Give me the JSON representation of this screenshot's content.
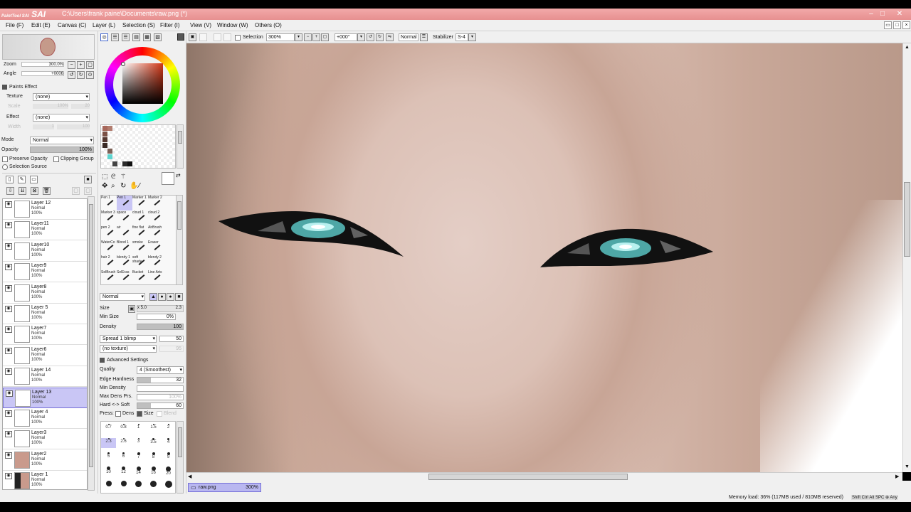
{
  "app": {
    "logo_text": "PaintTool SAI",
    "title": "C:\\Users\\frank paine\\Documents\\raw.png (*)",
    "win_min": "–",
    "win_max": "□",
    "win_close": "✕"
  },
  "menu": [
    "File (F)",
    "Edit (E)",
    "Canvas (C)",
    "Layer (L)",
    "Selection (S)",
    "Filter (I)",
    "View (V)",
    "Window (W)",
    "Others (O)"
  ],
  "navigator": {
    "zoom_label": "Zoom",
    "zoom_value": "300.0%",
    "angle_label": "Angle",
    "angle_value": "+0006"
  },
  "paints_effect": {
    "header": "Paints Effect",
    "texture_label": "Texture",
    "texture_value": "(none)",
    "texture_scale": "Scale",
    "texture_scale_value": "100%",
    "texture_scale_num": "20",
    "effect_label": "Effect",
    "effect_value": "(none)",
    "effect_width": "Width",
    "effect_width_num": "1",
    "effect_width_value": "100"
  },
  "layer_props": {
    "mode_label": "Mode",
    "mode_value": "Normal",
    "opacity_label": "Opacity",
    "opacity_value": "100%",
    "preserve_opacity": "Preserve Opacity",
    "clipping_group": "Clipping Group",
    "selection_source": "Selection Source"
  },
  "layers": [
    {
      "name": "Layer 12",
      "mode": "Normal",
      "opacity": "100%",
      "selected": false
    },
    {
      "name": "Layer11",
      "mode": "Normal",
      "opacity": "100%",
      "selected": false
    },
    {
      "name": "Layer10",
      "mode": "Normal",
      "opacity": "100%",
      "selected": false
    },
    {
      "name": "Layer9",
      "mode": "Normal",
      "opacity": "100%",
      "selected": false
    },
    {
      "name": "Layer8",
      "mode": "Normal",
      "opacity": "100%",
      "selected": false
    },
    {
      "name": "Layer 5",
      "mode": "Normal",
      "opacity": "100%",
      "selected": false
    },
    {
      "name": "Layer7",
      "mode": "Normal",
      "opacity": "100%",
      "selected": false
    },
    {
      "name": "Layer6",
      "mode": "Normal",
      "opacity": "100%",
      "selected": false
    },
    {
      "name": "Layer 14",
      "mode": "Normal",
      "opacity": "100%",
      "selected": false
    },
    {
      "name": "Layer 13",
      "mode": "Normal",
      "opacity": "100%",
      "selected": true
    },
    {
      "name": "Layer 4",
      "mode": "Normal",
      "opacity": "100%",
      "selected": false
    },
    {
      "name": "Layer3",
      "mode": "Normal",
      "opacity": "100%",
      "selected": false
    },
    {
      "name": "Layer2",
      "mode": "Normal",
      "opacity": "100%",
      "selected": false
    },
    {
      "name": "Layer 1",
      "mode": "Normal",
      "opacity": "100%",
      "selected": false
    }
  ],
  "swatch_colors": [
    "#a7685c",
    "#b27d6f",
    "#7b5146",
    "#543830",
    "#3a2a25",
    "#7d6157",
    "#5fd5d0",
    "#2b2b2b",
    "#111111",
    "#444444"
  ],
  "brushes": [
    [
      "Pen 1",
      "Pen 1",
      "Marker 1",
      "Marker 2",
      ""
    ],
    [
      "Marker 3",
      "space",
      "cloud 1",
      "cloud 2",
      ""
    ],
    [
      "pen 2",
      "air",
      "fine flat",
      "AirBrush",
      ""
    ],
    [
      "WaterCo",
      "Blood 1",
      "smoke",
      "Eraser",
      ""
    ],
    [
      "hair 2",
      "blendy 1",
      "soft shade",
      "blendy 2",
      ""
    ],
    [
      "SelBrush",
      "SelEras",
      "Bucket",
      "Line Arts",
      ""
    ]
  ],
  "brush_settings": {
    "mode": "Normal",
    "size_label": "Size",
    "size_mult": "x 5.0",
    "size_value": "2.3",
    "min_size_label": "Min Size",
    "min_size_value": "0%",
    "density_label": "Density",
    "density_value": "100",
    "shape": "Spread 1 blimp",
    "shape_value": "50",
    "texture": "(no texture)",
    "texture_value": "95",
    "advanced": "Advanced Settings",
    "quality_label": "Quality",
    "quality_value": "4 (Smoothest)",
    "edge_label": "Edge Hardness",
    "edge_value": "32",
    "min_density_label": "Min Density",
    "min_density_value": "",
    "max_dens_label": "Max Dens Prs.",
    "max_dens_value": "100%",
    "hard_soft_label": "Hard <-> Soft",
    "hard_soft_value": "60",
    "press_label": "Press:",
    "press_dens": "Dens",
    "press_size": "Size",
    "press_blend": "Blend"
  },
  "brush_sizes": [
    "0.7",
    "0.8",
    "1",
    "1.5",
    "2",
    "2.3",
    "2.6",
    "3",
    "3.5",
    "4",
    "5",
    "6",
    "7",
    "8",
    "9",
    "10",
    "12",
    "14",
    "16",
    "20",
    "",
    "",
    "",
    "",
    ""
  ],
  "canvas_toolbar": {
    "selection_label": "Selection",
    "zoom": "300%",
    "angle": "+000°",
    "blend": "Normal",
    "stabilizer_label": "Stabilizer",
    "stabilizer_value": "S-4"
  },
  "tab": {
    "name": "raw.png",
    "zoom": "300%"
  },
  "status": {
    "memory": "Memory load: 36% (117MB used / 810MB reserved)",
    "keys": "Shift Ctrl Alt SPC ⊕ Any"
  }
}
